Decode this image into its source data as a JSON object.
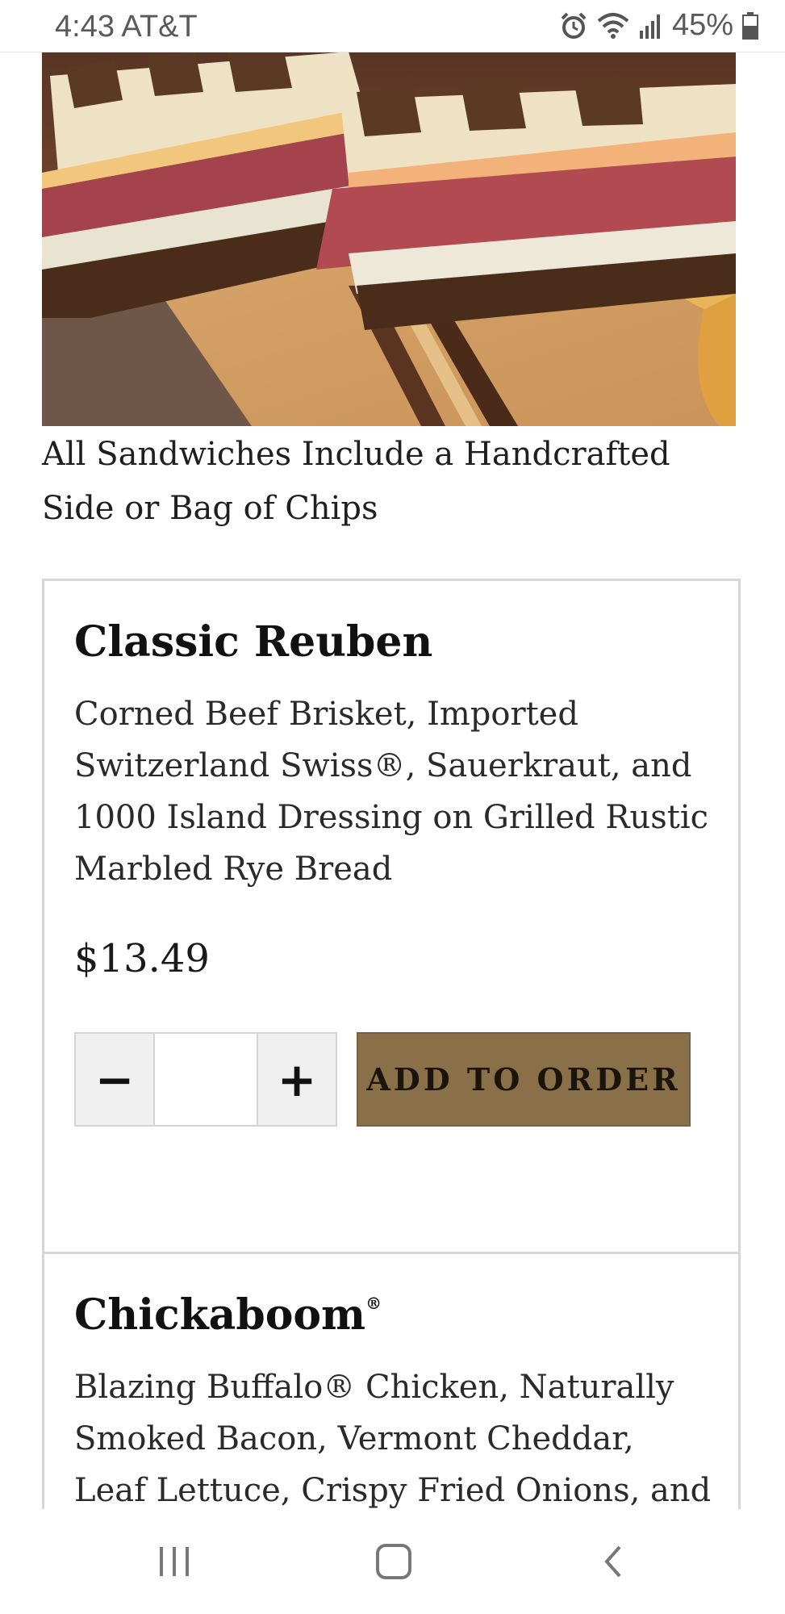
{
  "status_bar": {
    "time": "4:43",
    "carrier": "AT&T",
    "time_carrier": "4:43 AT&T",
    "battery": "45%",
    "icons": [
      "alarm-icon",
      "wifi-icon",
      "signal-icon",
      "battery-icon"
    ]
  },
  "hero": {
    "image": "reuben-sandwich-photo",
    "caption": "All Sandwiches Include a Handcrafted Side or Bag of Chips"
  },
  "items": [
    {
      "name": "Classic Reuben",
      "description": "Corned Beef Brisket, Imported Switzerland Swiss®, Sauerkraut, and 1000 Island Dressing on Grilled Rustic Marbled Rye Bread",
      "price": "$13.49",
      "quantity": "",
      "minus_label": "−",
      "plus_label": "+",
      "add_label": "ADD TO ORDER"
    },
    {
      "name": "Chickaboom",
      "name_mark": "®",
      "description": "Blazing Buffalo® Chicken, Naturally Smoked Bacon, Vermont Cheddar, Leaf Lettuce, Crispy Fried Onions, and"
    }
  ],
  "colors": {
    "accent_button": "#8a7049",
    "card_border": "#d6d6d6",
    "stepper_bg": "#f0f0f0"
  },
  "nav_bar": {
    "icons": [
      "recent-apps-icon",
      "home-icon",
      "back-icon"
    ]
  }
}
